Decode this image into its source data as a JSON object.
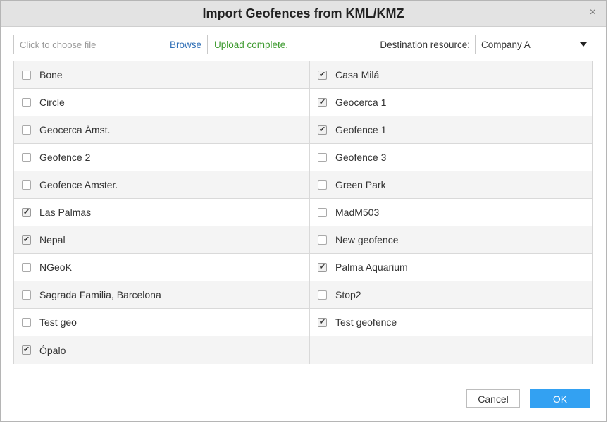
{
  "dialog": {
    "title": "Import Geofences from KML/KMZ",
    "close_glyph": "×"
  },
  "file": {
    "placeholder": "Click to choose file",
    "browse_label": "Browse",
    "status": "Upload complete."
  },
  "destination": {
    "label": "Destination resource:",
    "selected": "Company A"
  },
  "check_glyph": "✔",
  "geofences": [
    {
      "label": "Bone",
      "checked": false
    },
    {
      "label": "Casa Milá",
      "checked": true
    },
    {
      "label": "Circle",
      "checked": false
    },
    {
      "label": "Geocerca 1",
      "checked": true
    },
    {
      "label": "Geocerca Ámst.",
      "checked": false
    },
    {
      "label": "Geofence 1",
      "checked": true
    },
    {
      "label": "Geofence 2",
      "checked": false
    },
    {
      "label": "Geofence 3",
      "checked": false
    },
    {
      "label": "Geofence Amster.",
      "checked": false
    },
    {
      "label": "Green Park",
      "checked": false
    },
    {
      "label": "Las Palmas",
      "checked": true
    },
    {
      "label": "MadM503",
      "checked": false
    },
    {
      "label": "Nepal",
      "checked": true
    },
    {
      "label": "New geofence",
      "checked": false
    },
    {
      "label": "NGeoK",
      "checked": false
    },
    {
      "label": "Palma Aquarium",
      "checked": true
    },
    {
      "label": "Sagrada Familia, Barcelona",
      "checked": false
    },
    {
      "label": "Stop2",
      "checked": false
    },
    {
      "label": "Test geo",
      "checked": false
    },
    {
      "label": "Test geofence",
      "checked": true
    },
    {
      "label": "Ópalo",
      "checked": true
    },
    {
      "label": "",
      "checked": null
    }
  ],
  "buttons": {
    "cancel": "Cancel",
    "ok": "OK"
  }
}
